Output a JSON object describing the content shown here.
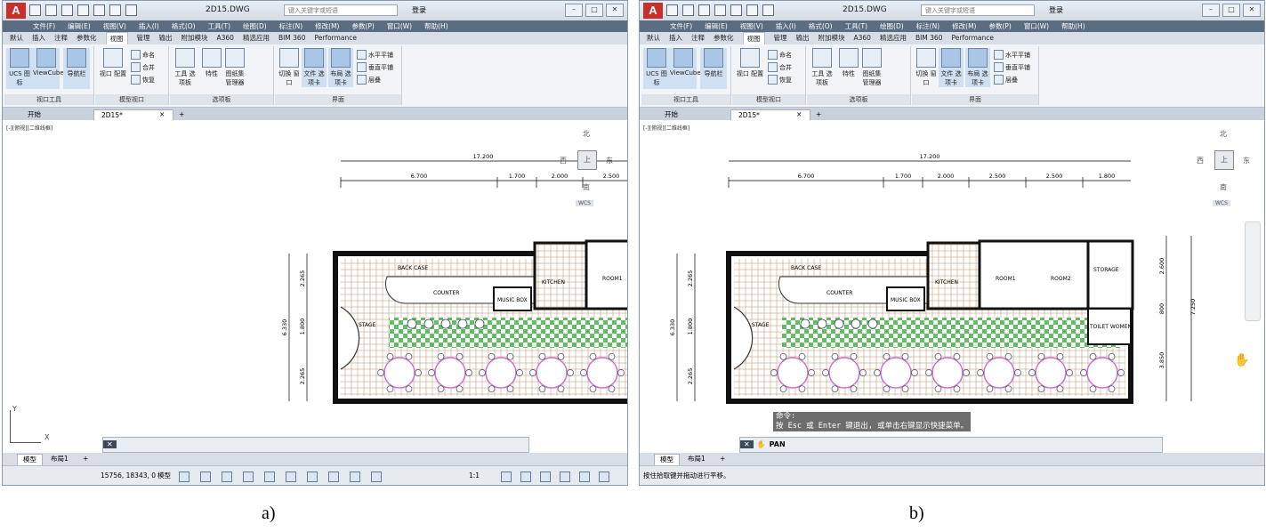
{
  "panels": [
    {
      "id": "a",
      "caption": "a)",
      "file_name": "2D15.DWG",
      "search_placeholder": "键入关键字或短语",
      "login": "登录",
      "menus": [
        "文件(F)",
        "编辑(E)",
        "视图(V)",
        "插入(I)",
        "格式(O)",
        "工具(T)",
        "绘图(D)",
        "标注(N)",
        "修改(M)",
        "参数(P)",
        "窗口(W)",
        "帮助(H)"
      ],
      "ribbon_tabs": [
        "默认",
        "插入",
        "注释",
        "参数化",
        "视图",
        "管理",
        "输出",
        "附加模块",
        "A360",
        "精选应用",
        "BIM 360",
        "Performance"
      ],
      "active_ribbon_tab": "视图",
      "ribbon": {
        "ucs_icon": "UCS\n图标",
        "viewcube": "ViewCube",
        "navbar": "导航栏",
        "viewport_config": "视口\n配置",
        "name": "命名",
        "join": "合并",
        "restore": "恢复",
        "tool_palettes": "工具\n选项板",
        "properties": "特性",
        "sheet_set": "图纸集\n管理器",
        "switch_window": "切换\n窗口",
        "file_tabs": "文件\n选项卡",
        "layout_tabs": "布局\n选项卡",
        "tile_h": "水平平铺",
        "tile_v": "垂直平铺",
        "cascade": "层叠",
        "group_viewport_tools": "视口工具",
        "group_model_viewport": "模型视口",
        "group_palettes": "选项板",
        "group_interface": "界面"
      },
      "doc_tabs": [
        "开始",
        "2D15*"
      ],
      "viewport_label": "[-][俯视][二维线框]",
      "viewcube": {
        "n": "北",
        "s": "南",
        "e": "东",
        "w": "西",
        "top": "上",
        "wcs": "WCS"
      },
      "dims": {
        "total": "17.200",
        "d1": "6.700",
        "d2": "1.700",
        "d3": "2.000",
        "d4": "2.500",
        "h_total": "6.330",
        "h1": "2.265",
        "h2": "1.800",
        "h3": "2.265"
      },
      "rooms": {
        "back_case": "BACK        CASE",
        "counter": "COUNTER",
        "music_box": "MUSIC  BOX",
        "kitchen": "KITCHEN",
        "room1": "ROOM1",
        "stage": "STAGE"
      },
      "cmd_hist": "",
      "cmd_input": "",
      "bottom_tabs": [
        "模型",
        "布局1"
      ],
      "coords": "15756, 18343, 0",
      "model_label": "模型",
      "scale": "1:1",
      "status_text": ""
    },
    {
      "id": "b",
      "caption": "b)",
      "file_name": "2D15.DWG",
      "search_placeholder": "键入关键字或短语",
      "login": "登录",
      "menus": [
        "文件(F)",
        "编辑(E)",
        "视图(V)",
        "插入(I)",
        "格式(O)",
        "工具(T)",
        "绘图(D)",
        "标注(N)",
        "修改(M)",
        "参数(P)",
        "窗口(W)",
        "帮助(H)"
      ],
      "ribbon_tabs": [
        "默认",
        "插入",
        "注释",
        "参数化",
        "视图",
        "管理",
        "输出",
        "附加模块",
        "A360",
        "精选应用",
        "BIM 360",
        "Performance"
      ],
      "active_ribbon_tab": "视图",
      "ribbon": {
        "ucs_icon": "UCS\n图标",
        "viewcube": "ViewCube",
        "navbar": "导航栏",
        "viewport_config": "视口\n配置",
        "name": "命名",
        "join": "合并",
        "restore": "恢复",
        "tool_palettes": "工具\n选项板",
        "properties": "特性",
        "sheet_set": "图纸集\n管理器",
        "switch_window": "切换\n窗口",
        "file_tabs": "文件\n选项卡",
        "layout_tabs": "布局\n选项卡",
        "tile_h": "水平平铺",
        "tile_v": "垂直平铺",
        "cascade": "层叠",
        "group_viewport_tools": "视口工具",
        "group_model_viewport": "模型视口",
        "group_palettes": "选项板",
        "group_interface": "界面"
      },
      "doc_tabs": [
        "开始",
        "2D15*"
      ],
      "viewport_label": "[-][俯视][二维线框]",
      "viewcube": {
        "n": "北",
        "s": "南",
        "e": "东",
        "w": "西",
        "top": "上",
        "wcs": "WCS"
      },
      "dims": {
        "total": "17.200",
        "d1": "6.700",
        "d2": "1.700",
        "d3": "2.000",
        "d4": "2.500",
        "d5": "2.500",
        "d6": "1.800",
        "h_total": "6.330",
        "h1": "2.265",
        "h2": "1.800",
        "h3": "2.265",
        "r_total": "7.250",
        "r1": "2.600",
        "r2": "800",
        "r3": "3.850"
      },
      "rooms": {
        "back_case": "BACK        CASE",
        "counter": "COUNTER",
        "music_box": "MUSIC  BOX",
        "kitchen": "KITCHEN",
        "room1": "ROOM1",
        "room2": "ROOM2",
        "storage": "STORAGE",
        "stage": "STAGE",
        "toilet": "TOILET WOMEN"
      },
      "cmd_hist": "命令:\n按 Esc 或 Enter 键退出, 或单击右键显示快捷菜单。",
      "cmd_input": "PAN",
      "bottom_tabs": [
        "模型",
        "布局1"
      ],
      "coords": "",
      "model_label": "",
      "scale": "",
      "status_text": "按住拾取键并拖动进行平移。"
    }
  ],
  "colors": {
    "app_red": "#c8302c",
    "menubar": "#5b6d80",
    "tile": "#c9a27c",
    "green": "#3cb043",
    "table": "#d070d0"
  }
}
